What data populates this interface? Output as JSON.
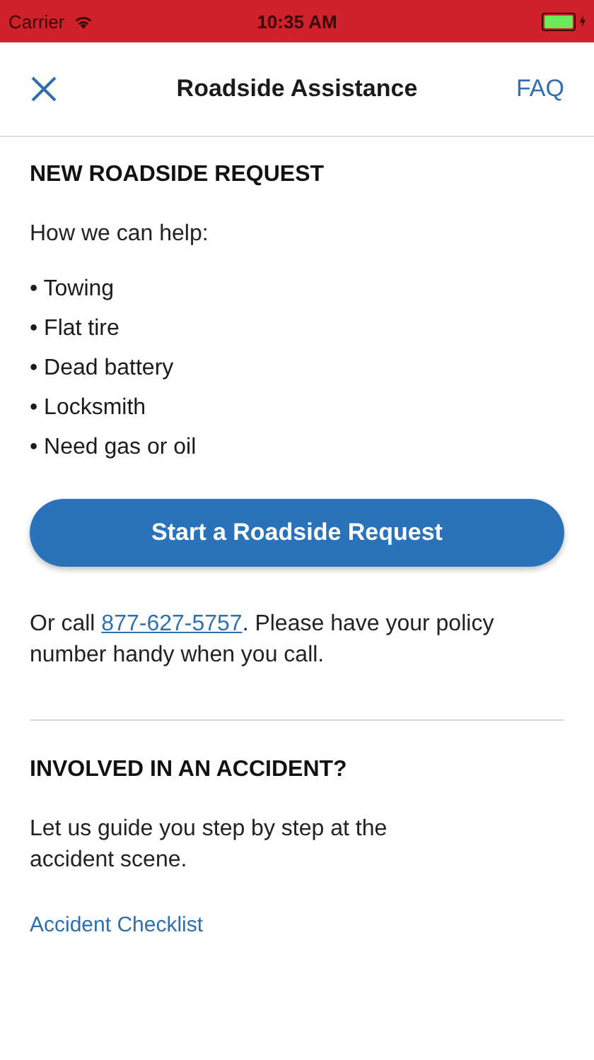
{
  "status_bar": {
    "carrier": "Carrier",
    "time": "10:35 AM"
  },
  "nav": {
    "title": "Roadside Assistance",
    "right": "FAQ"
  },
  "roadside": {
    "heading": "NEW ROADSIDE REQUEST",
    "intro": "How we can help:",
    "items": [
      "• Towing",
      "• Flat tire",
      "• Dead battery",
      "• Locksmith",
      "• Need gas or oil"
    ],
    "button": "Start a Roadside Request",
    "call": {
      "before": "Or call ",
      "phone": "877-627-5757",
      "after": ". Please have your policy number handy when you call."
    }
  },
  "accident": {
    "heading": "INVOLVED IN AN ACCIDENT?",
    "text": "Let us guide you step by step at the accident scene.",
    "link": "Accident Checklist"
  }
}
